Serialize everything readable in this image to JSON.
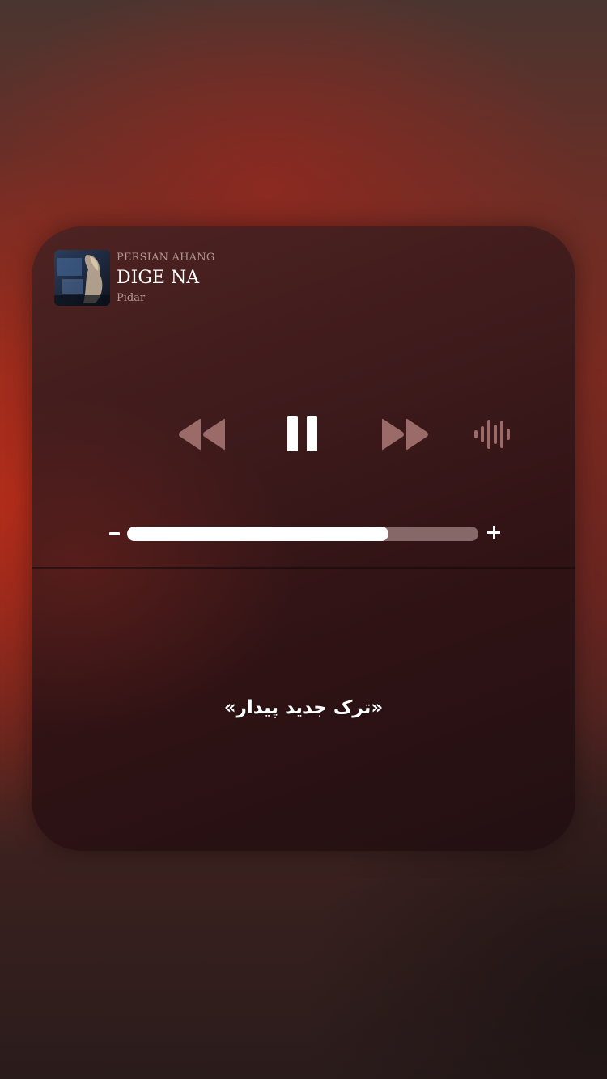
{
  "now_playing": {
    "source": "PERSIAN AHANG",
    "title": "DIGE NA",
    "artist": "Pidar",
    "artwork_icon": "album-cover-image"
  },
  "controls": {
    "rewind_icon": "rewind-icon",
    "pause_icon": "pause-icon",
    "forward_icon": "fast-forward-icon",
    "audio_output_icon": "waveform-icon"
  },
  "volume": {
    "level": 0.745,
    "minus_icon": "volume-minus-icon",
    "plus_icon": "volume-plus-icon"
  },
  "caption": "«ترک جدید پیدار»",
  "colors": {
    "card_background": "#3d1a1b",
    "control_icon": "#9a6b68",
    "volume_fill": "#ffffff",
    "volume_track": "#b9a0a0"
  }
}
